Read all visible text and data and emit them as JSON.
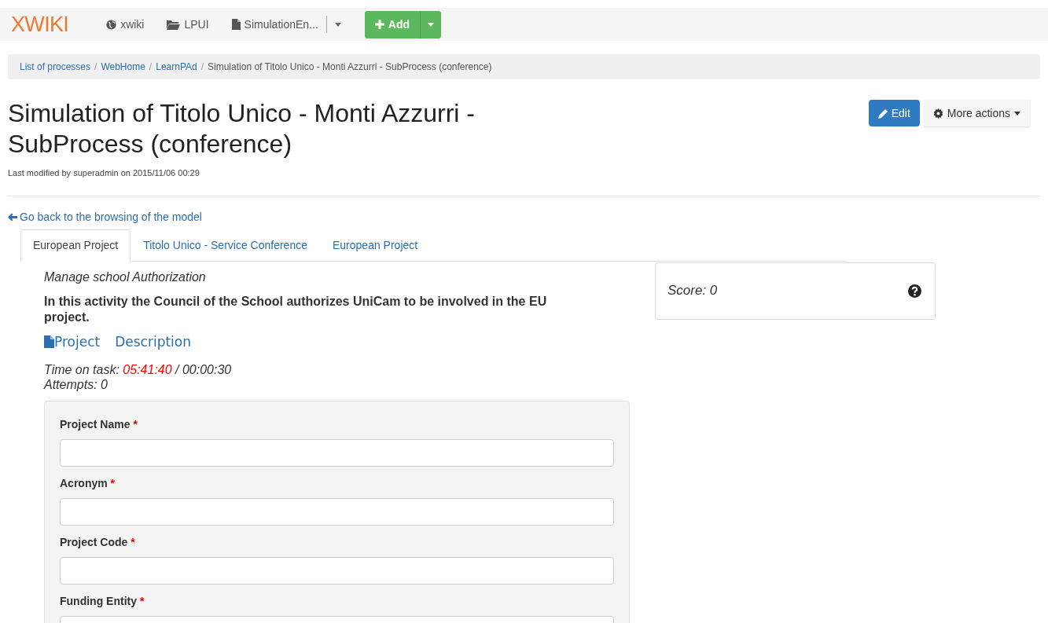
{
  "navbar": {
    "logo": "XWIKI",
    "items": [
      {
        "kind": "globe",
        "label": "xwiki"
      },
      {
        "kind": "folder",
        "label": "LPUI"
      },
      {
        "kind": "file",
        "label": "SimulationEn..."
      }
    ],
    "add_button": "Add"
  },
  "breadcrumb": [
    {
      "label": "List of processes",
      "current": false
    },
    {
      "label": "WebHome",
      "current": false
    },
    {
      "label": "LearnPAd",
      "current": false
    },
    {
      "label": "Simulation of Titolo Unico - Monti Azzurri - SubProcess (conference)",
      "current": true
    }
  ],
  "breadcrumb_separator": "/",
  "title": "Simulation of Titolo Unico - Monti Azzurri - SubProcess (conference)",
  "edit_button": "Edit",
  "more_actions_button": "More actions",
  "last_modified": "Last modified by superadmin on 2015/11/06 00:29",
  "back_link": "Go back to the browsing of the model",
  "tabs": [
    {
      "label": "European Project",
      "selected": true
    },
    {
      "label": "Titolo Unico - Service Conference",
      "selected": false
    },
    {
      "label": "European Project",
      "selected": false
    }
  ],
  "activity": {
    "name": "Manage school Authorization",
    "description": "In this activity the Council of the School authorizes UniCam to be involved in the EU project.",
    "doc_links": [
      "Project",
      "Description"
    ],
    "time_label": "Time on task:",
    "time_spent": "05:41:40",
    "time_limit": "/ 00:00:30",
    "attempts": "Attempts: 0"
  },
  "score": {
    "label": "Score: 0"
  },
  "form": {
    "fields": [
      {
        "label": "Project Name",
        "required_mark": "*"
      },
      {
        "label": "Acronym",
        "required_mark": "*"
      },
      {
        "label": "Project Code",
        "required_mark": "*"
      },
      {
        "label": "Funding Entity",
        "required_mark": "*"
      }
    ]
  }
}
